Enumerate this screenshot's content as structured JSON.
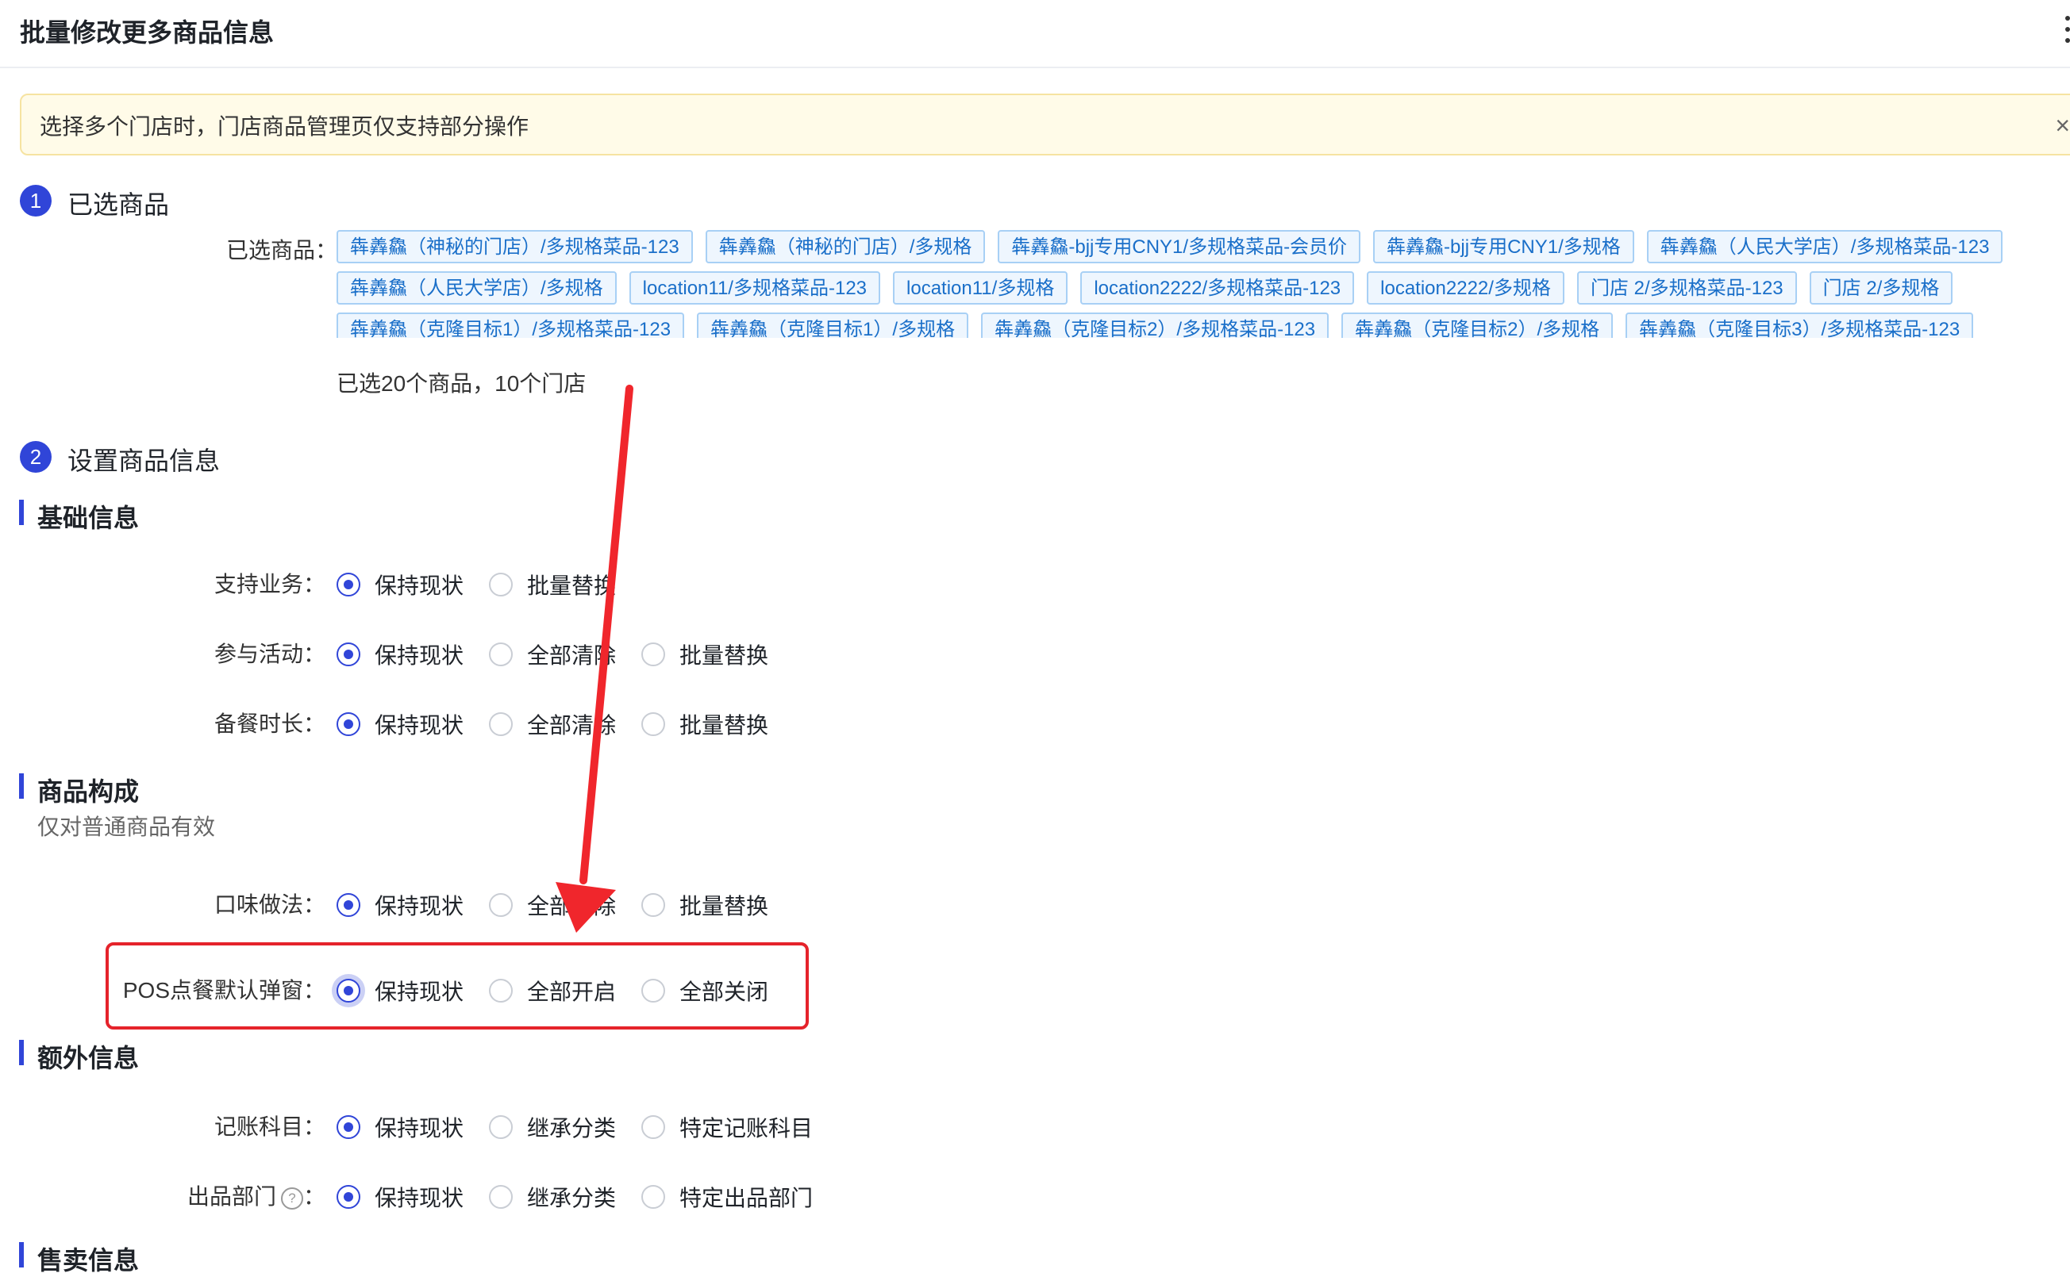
{
  "header": {
    "title": "批量修改更多商品信息"
  },
  "alert": {
    "text": "选择多个门店时，门店商品管理页仅支持部分操作",
    "close": "×"
  },
  "step1": {
    "number": "1",
    "title": "已选商品"
  },
  "selected": {
    "label": "已选商品：",
    "tags_row1": [
      "犇羴鱻（神秘的门店）/多规格菜品-123",
      "犇羴鱻（神秘的门店）/多规格",
      "犇羴鱻-bjj专用CNY1/多规格菜品-会员价",
      "犇羴鱻-bjj专用CNY1/多规格",
      "犇羴鱻（人民大学店）/多规格菜品-123"
    ],
    "tags_row2": [
      "犇羴鱻（人民大学店）/多规格",
      "location11/多规格菜品-123",
      "location11/多规格",
      "location2222/多规格菜品-123",
      "location2222/多规格",
      "门店 2/多规格菜品-123",
      "门店 2/多规格"
    ],
    "tags_row3": [
      "犇羴鱻（克隆目标1）/多规格菜品-123",
      "犇羴鱻（克隆目标1）/多规格",
      "犇羴鱻（克隆目标2）/多规格菜品-123",
      "犇羴鱻（克隆目标2）/多规格",
      "犇羴鱻（克隆目标3）/多规格菜品-123"
    ],
    "count": "已选20个商品，10个门店"
  },
  "step2": {
    "number": "2",
    "title": "设置商品信息"
  },
  "sections": {
    "basic": {
      "title": "基础信息"
    },
    "composition": {
      "title": "商品构成",
      "subtitle": "仅对普通商品有效"
    },
    "extra": {
      "title": "额外信息"
    },
    "sale": {
      "title": "售卖信息"
    }
  },
  "rows": {
    "business": {
      "label": "支持业务：",
      "options": [
        "保持现状",
        "批量替换"
      ],
      "selected": 0
    },
    "activity": {
      "label": "参与活动：",
      "options": [
        "保持现状",
        "全部清除",
        "批量替换"
      ],
      "selected": 0
    },
    "prep": {
      "label": "备餐时长：",
      "options": [
        "保持现状",
        "全部清除",
        "批量替换"
      ],
      "selected": 0
    },
    "flavor": {
      "label": "口味做法：",
      "options": [
        "保持现状",
        "全部清除",
        "批量替换"
      ],
      "selected": 0
    },
    "pos": {
      "label": "POS点餐默认弹窗：",
      "options": [
        "保持现状",
        "全部开启",
        "全部关闭"
      ],
      "selected": 0
    },
    "account": {
      "label": "记账科目：",
      "options": [
        "保持现状",
        "继承分类",
        "特定记账科目"
      ],
      "selected": 0
    },
    "dept": {
      "label": "出品部门",
      "colon": "：",
      "help": "?",
      "options": [
        "保持现状",
        "继承分类",
        "特定出品部门"
      ],
      "selected": 0
    }
  },
  "colors": {
    "primary": "#3045d8",
    "highlight": "#e5232b",
    "arrow": "#f0262c"
  }
}
